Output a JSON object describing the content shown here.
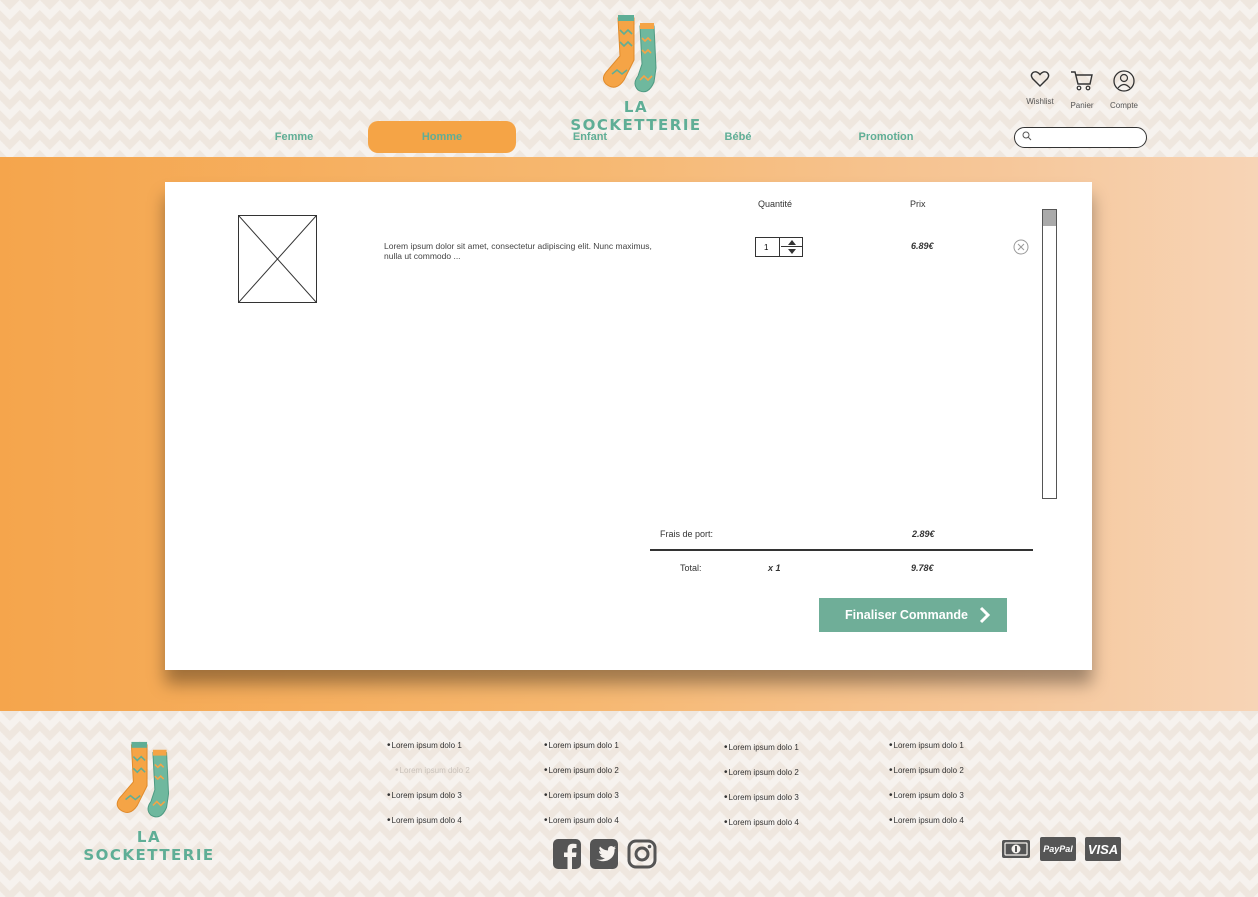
{
  "brand": {
    "name": "LA SOCKETTERIE"
  },
  "header": {
    "icons": [
      {
        "name": "heart-icon",
        "label": "Wishlist"
      },
      {
        "name": "cart-icon",
        "label": "Panier"
      },
      {
        "name": "user-icon",
        "label": "Compte"
      }
    ],
    "nav": [
      {
        "label": "Femme"
      },
      {
        "label": "Homme",
        "active": true
      },
      {
        "label": "Enfant"
      },
      {
        "label": "Bébé"
      },
      {
        "label": "Promotion"
      }
    ],
    "search": {
      "value": "",
      "placeholder": ""
    }
  },
  "cart": {
    "columns": {
      "quantity": "Quantité",
      "price": "Prix"
    },
    "items": [
      {
        "description": "Lorem ipsum dolor sit amet, consectetur adipiscing elit. Nunc maximus, nulla ut commodo  ...",
        "quantity": "1",
        "price": "6.89€"
      }
    ],
    "shipping_label": "Frais de port:",
    "shipping_value": "2.89€",
    "total_label": "Total:",
    "total_count": "x 1",
    "total_value": "9.78€",
    "checkout_label": "Finaliser Commande"
  },
  "footer": {
    "columns": [
      [
        "Lorem ipsum dolo 1",
        "Lorem ipsum dolo 2",
        "Lorem ipsum dolo 3",
        "Lorem ipsum dolo 4"
      ],
      [
        "Lorem ipsum dolo 1",
        "Lorem ipsum dolo 2",
        "Lorem ipsum dolo 3",
        "Lorem ipsum dolo 4"
      ],
      [
        "Lorem ipsum dolo 1",
        "Lorem ipsum dolo 2",
        "Lorem ipsum dolo 3",
        "Lorem ipsum dolo 4"
      ],
      [
        "Lorem ipsum dolo 1",
        "Lorem ipsum dolo 2",
        "Lorem ipsum dolo 3",
        "Lorem ipsum dolo 4"
      ]
    ],
    "social": [
      "facebook-icon",
      "twitter-icon",
      "instagram-icon"
    ],
    "payments": {
      "paypal": "PayPal",
      "visa": "VISA"
    }
  },
  "colors": {
    "accent": "#f5a446",
    "brand_green": "#5fae96",
    "button": "#6fae98"
  }
}
